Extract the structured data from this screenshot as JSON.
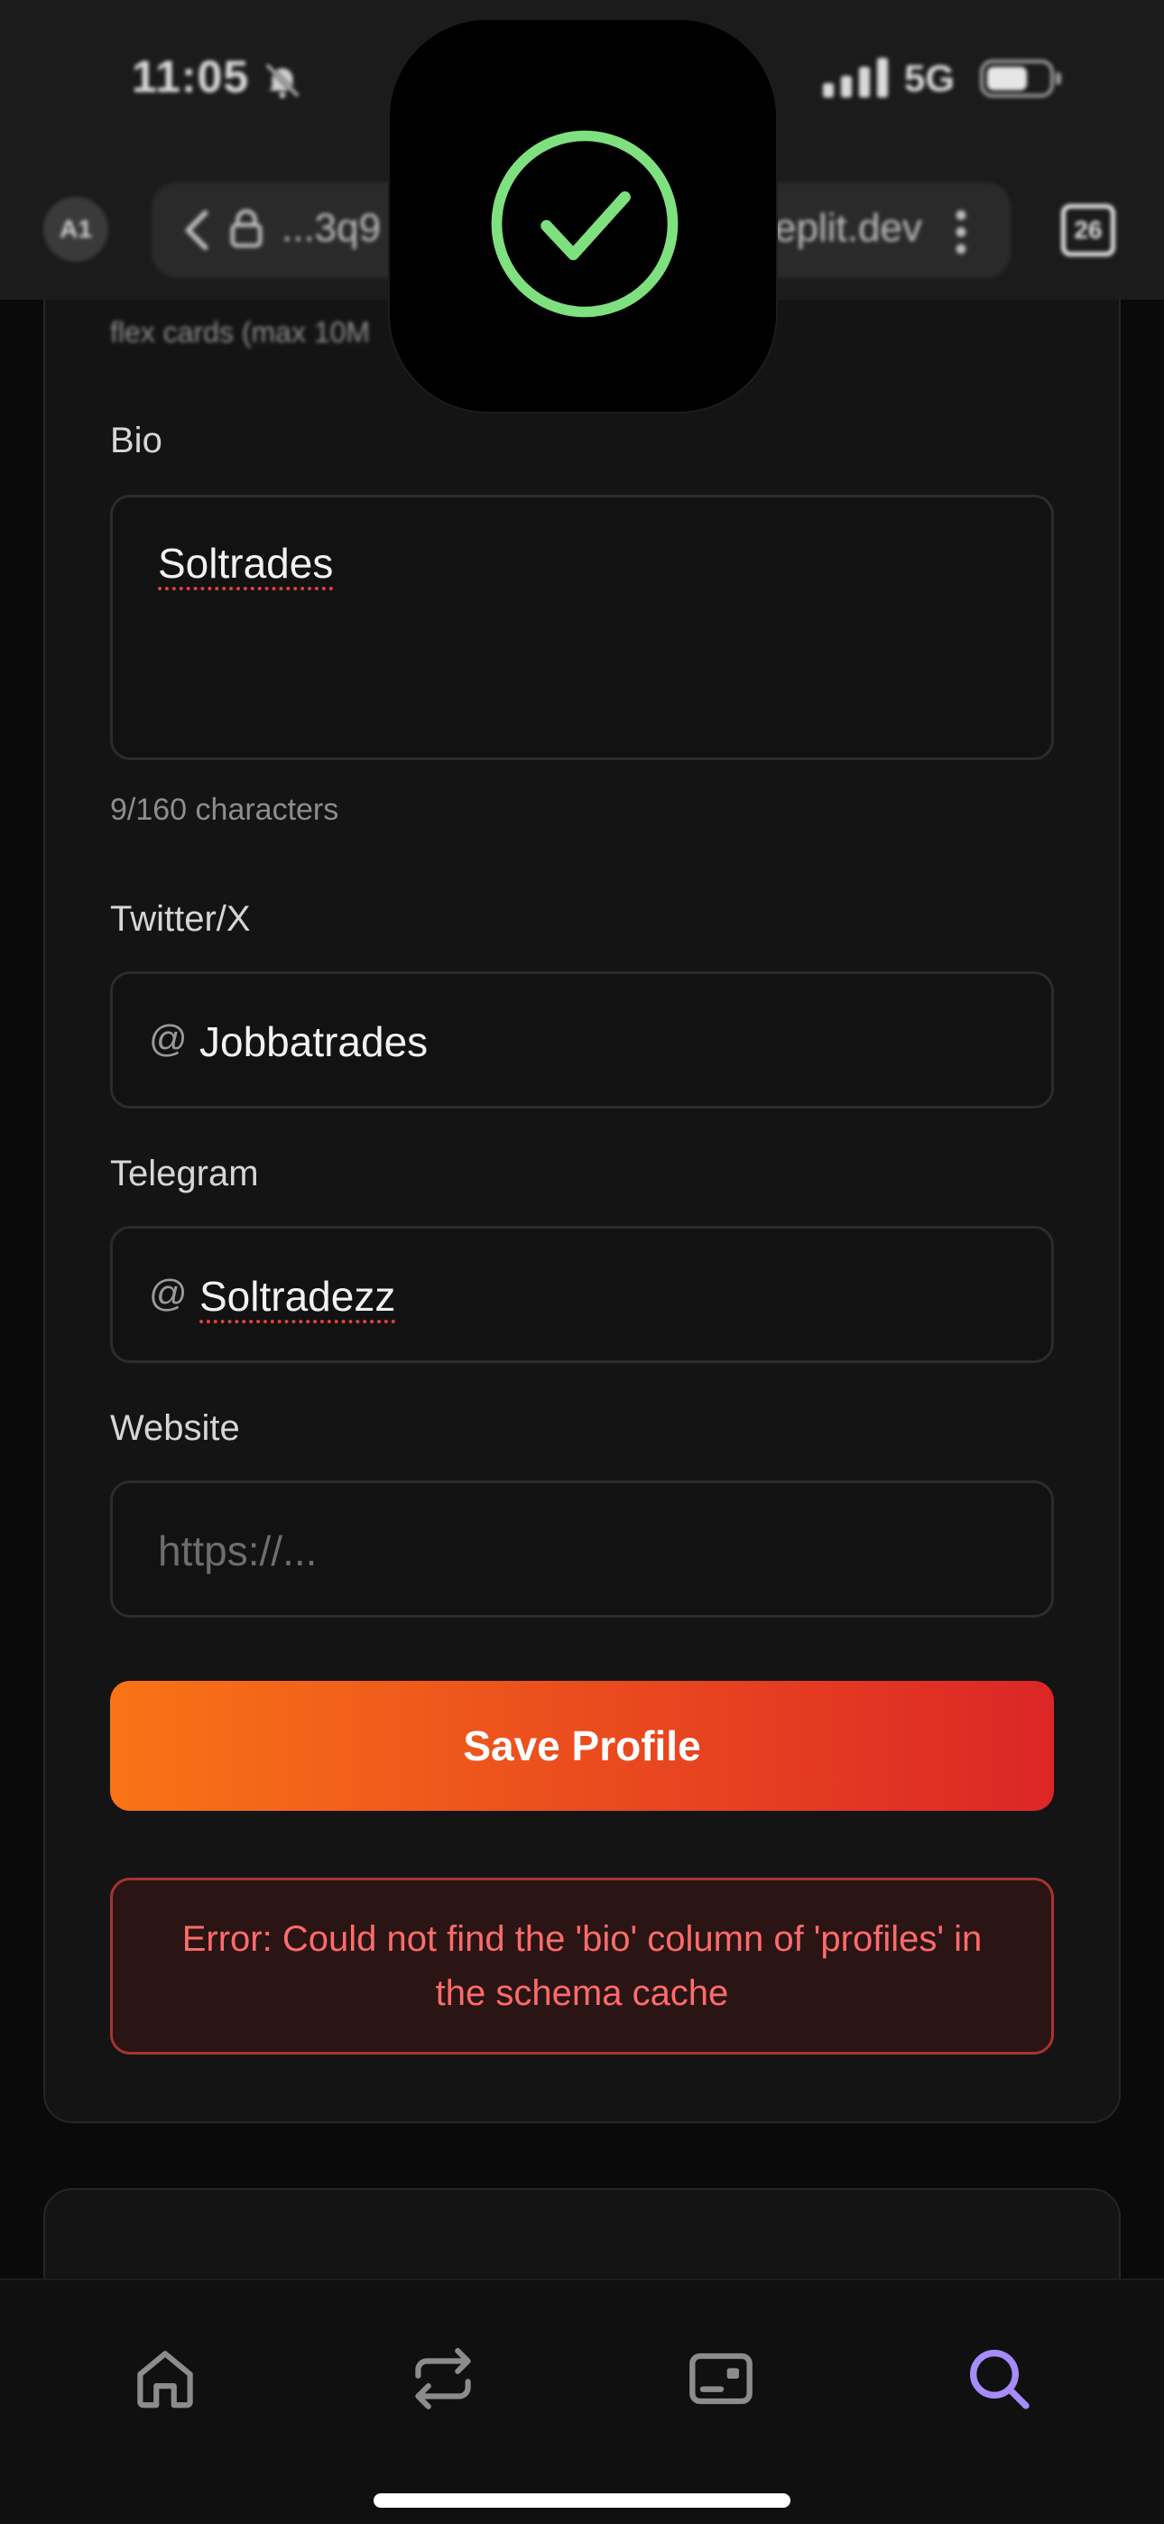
{
  "status_bar": {
    "time": "11:05",
    "network": "5G"
  },
  "browser": {
    "account_badge": "A1",
    "url_left": "...3q9",
    "url_right": "eplit.dev",
    "tab_count": "26"
  },
  "form": {
    "hint_text": "flex cards (max 10M",
    "bio": {
      "label": "Bio",
      "value": "Soltrades",
      "char_count": "9/160 characters"
    },
    "twitter": {
      "label": "Twitter/X",
      "prefix": "@",
      "value": "Jobbatrades"
    },
    "telegram": {
      "label": "Telegram",
      "prefix": "@",
      "value": "Soltradezz"
    },
    "website": {
      "label": "Website",
      "placeholder": "https://..."
    },
    "save_button": "Save Profile",
    "error": "Error: Could not find the 'bio' column of 'profiles' in the schema cache"
  },
  "bottom_nav": {
    "items": [
      {
        "icon": "home-icon",
        "active": false
      },
      {
        "icon": "swap-icon",
        "active": false
      },
      {
        "icon": "card-icon",
        "active": false
      },
      {
        "icon": "search-icon",
        "active": true
      }
    ]
  },
  "colors": {
    "accent": "#a78bfa",
    "button_gradient_start": "#f97316",
    "button_gradient_end": "#dc2626",
    "error_text": "#ff6b6b",
    "success": "#7ee07e"
  }
}
